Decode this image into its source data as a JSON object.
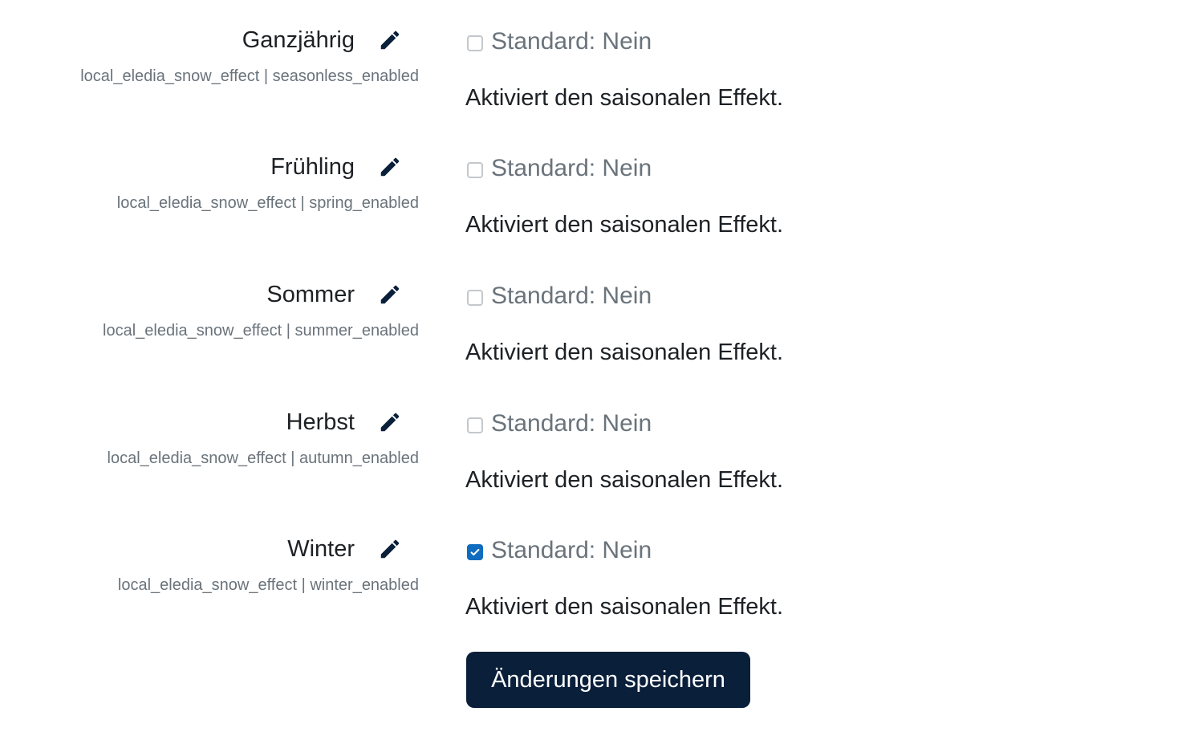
{
  "settings": [
    {
      "title": "Ganzjährig",
      "key": "local_eledia_snow_effect | seasonless_enabled",
      "default": "Standard: Nein",
      "checked": false,
      "description": "Aktiviert den saisonalen Effekt."
    },
    {
      "title": "Frühling",
      "key": "local_eledia_snow_effect | spring_enabled",
      "default": "Standard: Nein",
      "checked": false,
      "description": "Aktiviert den saisonalen Effekt."
    },
    {
      "title": "Sommer",
      "key": "local_eledia_snow_effect | summer_enabled",
      "default": "Standard: Nein",
      "checked": false,
      "description": "Aktiviert den saisonalen Effekt."
    },
    {
      "title": "Herbst",
      "key": "local_eledia_snow_effect | autumn_enabled",
      "default": "Standard: Nein",
      "checked": false,
      "description": "Aktiviert den saisonalen Effekt."
    },
    {
      "title": "Winter",
      "key": "local_eledia_snow_effect | winter_enabled",
      "default": "Standard: Nein",
      "checked": true,
      "description": "Aktiviert den saisonalen Effekt."
    }
  ],
  "save_button": {
    "label": "Änderungen speichern"
  },
  "colors": {
    "primary_button": "#0a1f3a",
    "checkbox_checked": "#0f6cbf",
    "icon": "#0a1f3a",
    "muted_text": "#6a737b"
  },
  "icons": {
    "edit": "pencil-icon",
    "check": "checkmark-icon"
  }
}
